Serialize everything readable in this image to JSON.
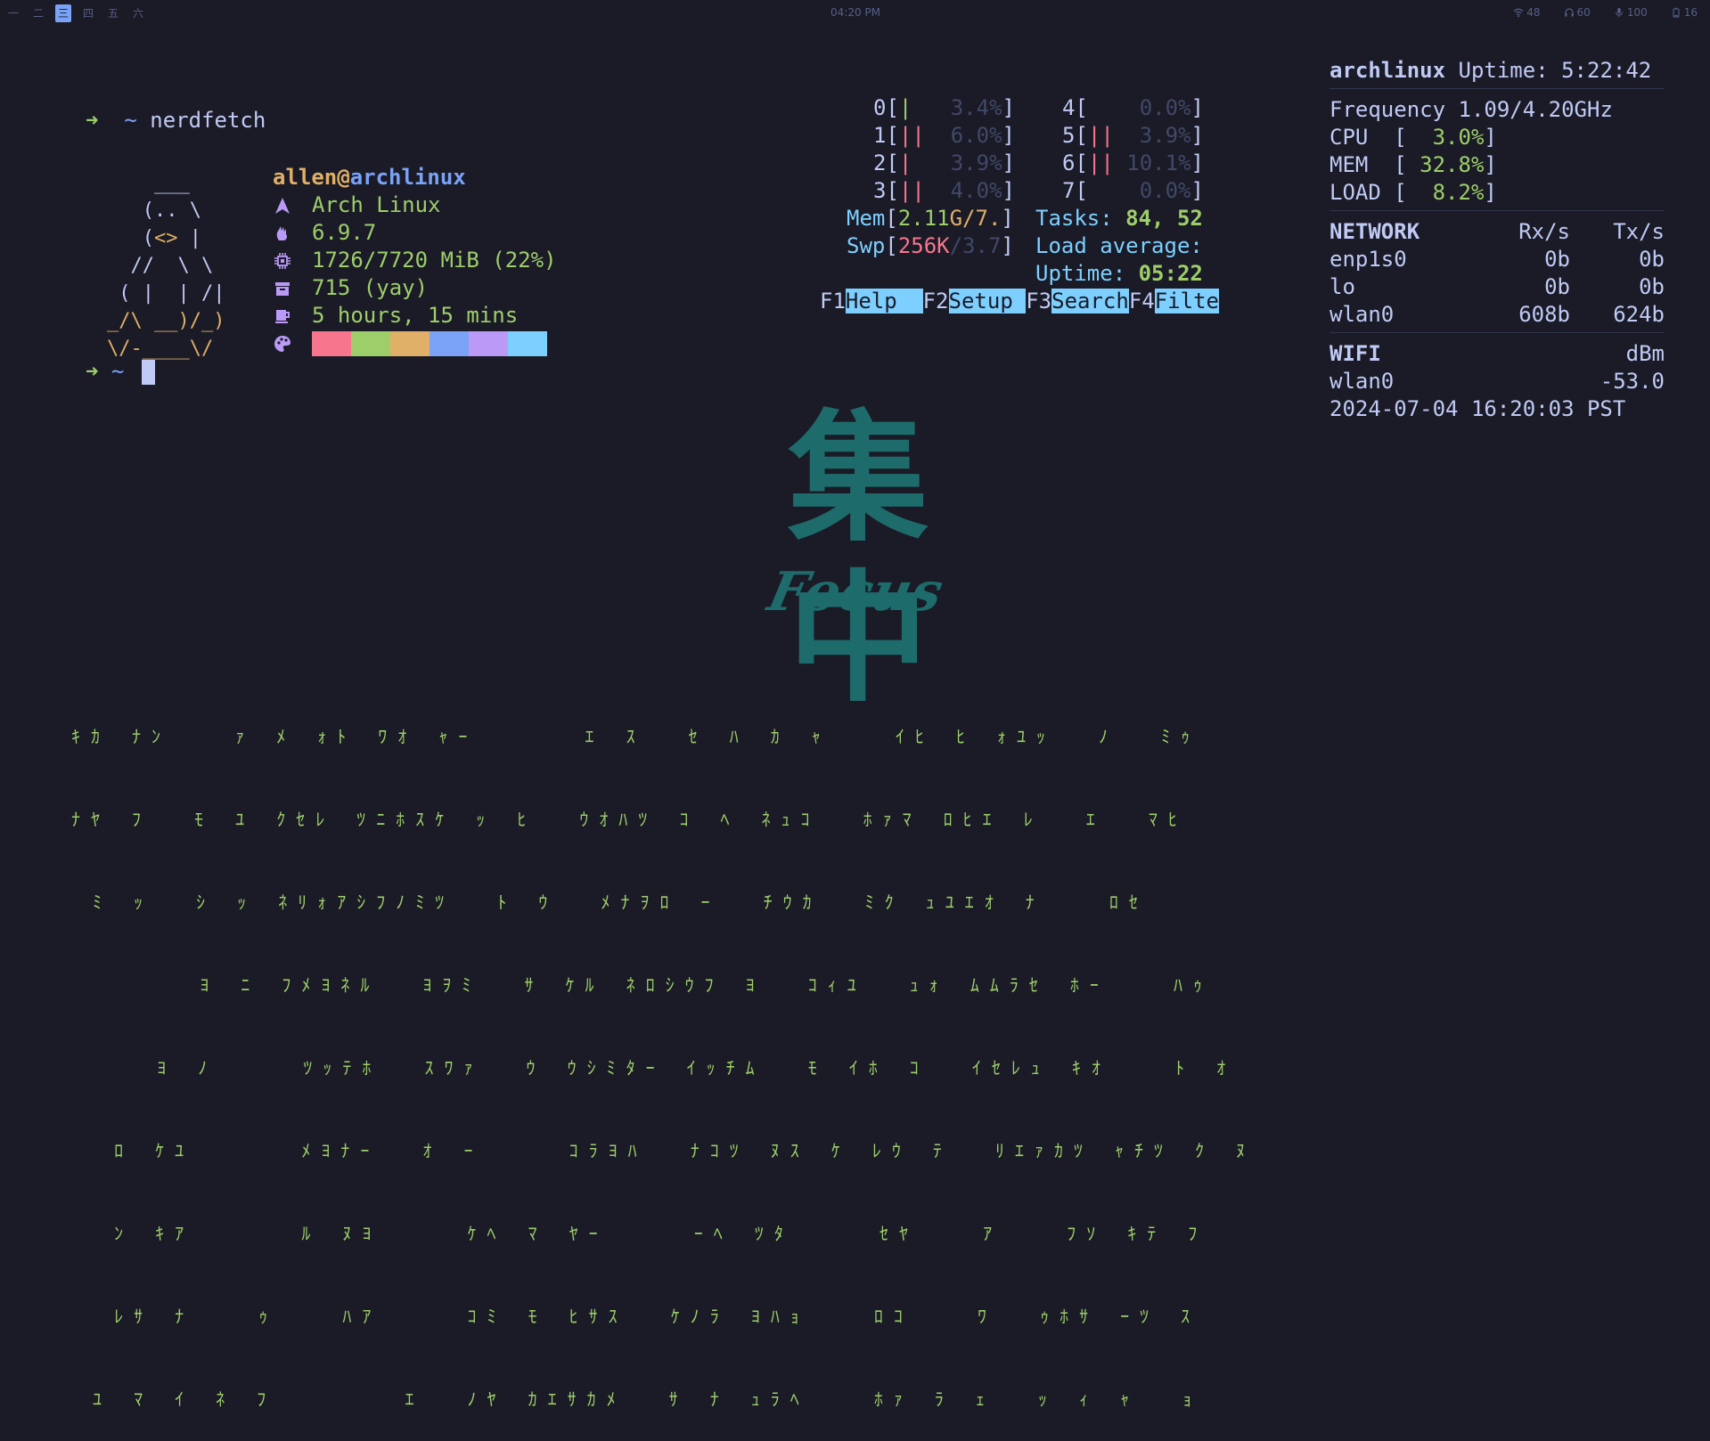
{
  "topbar": {
    "workspaces": [
      "一",
      "二",
      "三",
      "四",
      "五",
      "六"
    ],
    "active_workspace": 2,
    "clock": "04:20 PM",
    "status": {
      "wifi": "48",
      "headphones": "60",
      "mic": "100",
      "battery": "16"
    }
  },
  "terminal": {
    "prompt_symbol": "➜",
    "tilde": "~",
    "command": "nerdfetch",
    "user": "allen",
    "at": "@",
    "host": "archlinux",
    "info": [
      {
        "icon": "arch-icon",
        "value": "Arch Linux"
      },
      {
        "icon": "kernel-icon",
        "value": "6.9.7"
      },
      {
        "icon": "chip-icon",
        "value": "1726/7720 MiB (22%)"
      },
      {
        "icon": "package-icon",
        "value": "715 (yay)"
      },
      {
        "icon": "coffee-icon",
        "value": "5 hours, 15 mins"
      },
      {
        "icon": "palette-icon",
        "value": ""
      }
    ],
    "palette": [
      "#f7768e",
      "#9ece6a",
      "#e0af68",
      "#7aa2f7",
      "#bb9af7",
      "#7dcfff"
    ]
  },
  "htop": {
    "cpus": [
      {
        "id": "0",
        "bars": "|",
        "pct": "3.4%"
      },
      {
        "id": "1",
        "bars": "||",
        "pct": "6.0%"
      },
      {
        "id": "2",
        "bars": "|",
        "pct": "3.9%"
      },
      {
        "id": "3",
        "bars": "||",
        "pct": "4.0%"
      },
      {
        "id": "4",
        "bars": "",
        "pct": "0.0%"
      },
      {
        "id": "5",
        "bars": "||",
        "pct": "3.9%"
      },
      {
        "id": "6",
        "bars": "||",
        "pct": "10.1%"
      },
      {
        "id": "7",
        "bars": "",
        "pct": "0.0%"
      }
    ],
    "mem_label": "Mem",
    "mem_used": "2.11",
    "mem_total": "G/7.",
    "swp_label": "Swp",
    "swp_used": "256K",
    "swp_total": "/3.7",
    "tasks_label": "Tasks:",
    "tasks_value": "84, 52",
    "load_label": "Load average:",
    "uptime_label": "Uptime:",
    "uptime_value": "05:22",
    "fkeys": [
      {
        "key": "F1",
        "label": "Help  "
      },
      {
        "key": "F2",
        "label": "Setup "
      },
      {
        "key": "F3",
        "label": "Search"
      },
      {
        "key": "F4",
        "label": "Filte"
      }
    ]
  },
  "conky": {
    "host": "archlinux",
    "uptime_label": "Uptime:",
    "uptime": "5:22:42",
    "frequency_label": "Frequency",
    "frequency": "1.09/4.20GHz",
    "cpu_label": "CPU",
    "cpu": "3.0%",
    "mem_label": "MEM",
    "mem": "32.8%",
    "load_label": "LOAD",
    "load": "8.2%",
    "network_header": "NETWORK",
    "rx_header": "Rx/s",
    "tx_header": "Tx/s",
    "interfaces": [
      {
        "name": "enp1s0",
        "rx": "0b",
        "tx": "0b"
      },
      {
        "name": "lo",
        "rx": "0b",
        "tx": "0b"
      },
      {
        "name": "wlan0",
        "rx": "608b",
        "tx": "624b"
      }
    ],
    "wifi_header": "WIFI",
    "dbm_header": "dBm",
    "wifi_iface": "wlan0",
    "wifi_dbm": "-53.0",
    "datetime": "2024-07-04 16:20:03 PST"
  },
  "focus": {
    "kanji": "集中",
    "word": "Focus"
  },
  "rain": [
    "ｷｶ ﾅﾝ   ｧ ﾒ ｫﾄ ﾜｵ ｬｰ     ｴ ｽ  ｾ ﾊ ｶ ｬ   ｲﾋ ﾋ ｫﾕｯ  ﾉ  ﾐｩ",
    "ﾅﾔ ﾌ  ﾓ ﾕ ｸｾﾚ ﾂﾆﾎｽｹ ｯ ﾋ  ｳｵﾊﾂ ｺ ﾍ ﾈｭｺ  ﾎｧﾏ ﾛﾋｴ ﾚ  ｴ  ﾏﾋ",
    " ﾐ ｯ  ｼ ｯ ﾈﾘｫｱｼﾌﾉﾐﾂ  ﾄ ｳ  ﾒﾅｦﾛ ｰ  ﾁｳｶ  ﾐｸ ｭﾕｴｵ ﾅ   ﾛｾ",
    "      ﾖ ﾆ ﾌﾒﾖﾈﾙ  ﾖｦﾐ  ｻ ｹﾙ ﾈﾛｼｳﾌ ﾖ  ｺｨﾕ  ｭｫ ﾑﾑﾗｾ ﾎｰ   ﾊｩ",
    "    ﾖ ﾉ    ﾂｯﾃﾎ  ｽﾜｧ  ｳ ｳｼﾐﾀｰ ｲｯﾁﾑ  ﾓ ｲﾎ ｺ  ｲｾﾚｭ ｷｵ   ﾄ ｵ",
    "  ﾛ ｹﾕ     ﾒﾖﾅｰ  ｵ ｰ    ｺﾗﾖﾊ  ﾅｺﾂ ﾇｽ ｹ ﾚｳ ﾃ  ﾘｴｧｶﾂ ｬﾁﾂ ｸ ﾇ",
    "  ﾝ ｷｱ     ﾙ ﾇﾖ    ｹﾍ ﾏ ﾔｰ    ｰﾍ ﾂﾀ    ｾﾔ   ｱ   ﾌｿ ｷﾃ ﾌ",
    "  ﾚｻ ﾅ   ｩ   ﾊｱ    ｺﾐ ﾓ ﾋｻｽ  ｹﾉﾗ ﾖﾊｮ   ﾛｺ   ﾜ  ｩﾎｻ ｰﾂ ｽ",
    " ﾕ ﾏ ｲ ﾈ ﾌ      ｴ  ﾉﾔ ｶｴｻｶﾒ  ｻ ﾅ ｭﾗﾍ   ﾎｧ ﾗ ｪ  ｯ ｨ ｬ  ｮ"
  ]
}
